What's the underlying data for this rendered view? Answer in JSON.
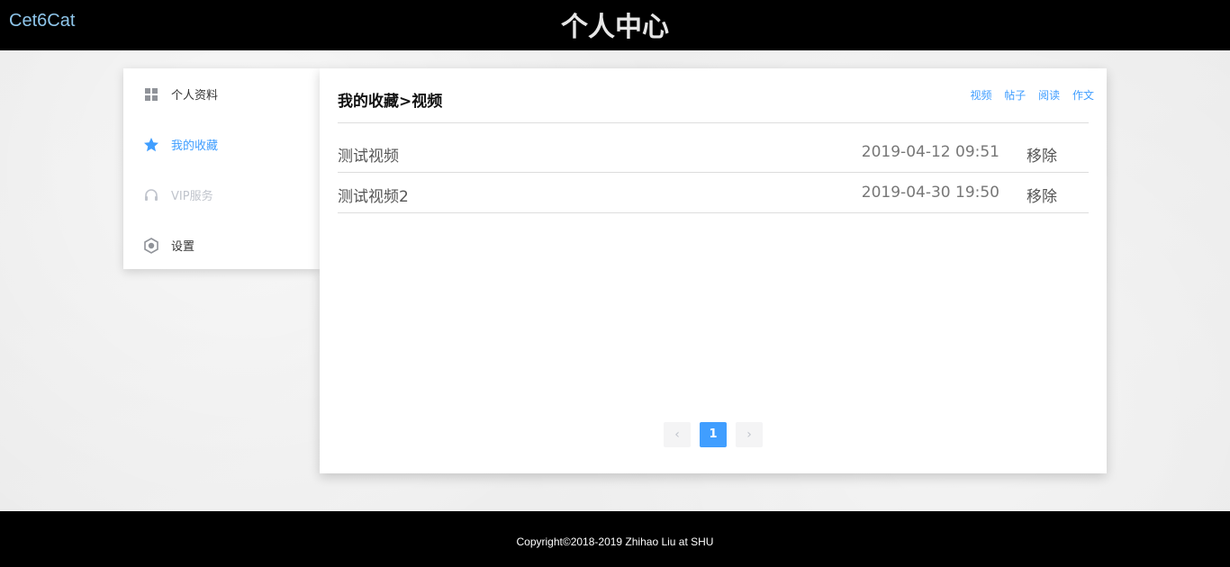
{
  "header": {
    "brand": "Cet6Cat",
    "title": "个人中心"
  },
  "sidebar": {
    "items": [
      {
        "label": "个人资料",
        "icon": "grid-icon",
        "state": "normal"
      },
      {
        "label": "我的收藏",
        "icon": "star-icon",
        "state": "active"
      },
      {
        "label": "VIP服务",
        "icon": "headset-icon",
        "state": "disabled"
      },
      {
        "label": "设置",
        "icon": "settings-icon",
        "state": "normal"
      }
    ]
  },
  "main": {
    "title": "我的收藏>视频",
    "filters": [
      "视频",
      "帖子",
      "阅读",
      "作文"
    ],
    "rows": [
      {
        "name": "测试视频",
        "time": "2019-04-12 09:51",
        "action": "移除"
      },
      {
        "name": "测试视频2",
        "time": "2019-04-30 19:50",
        "action": "移除"
      }
    ],
    "pagination": {
      "prev": "‹",
      "current": "1",
      "next": "›"
    }
  },
  "footer": {
    "copyright": "Copyright©2018-2019 Zhihao Liu at SHU"
  },
  "colors": {
    "accent": "#409eff",
    "brand": "#8ec5ea",
    "bar": "#000000"
  }
}
